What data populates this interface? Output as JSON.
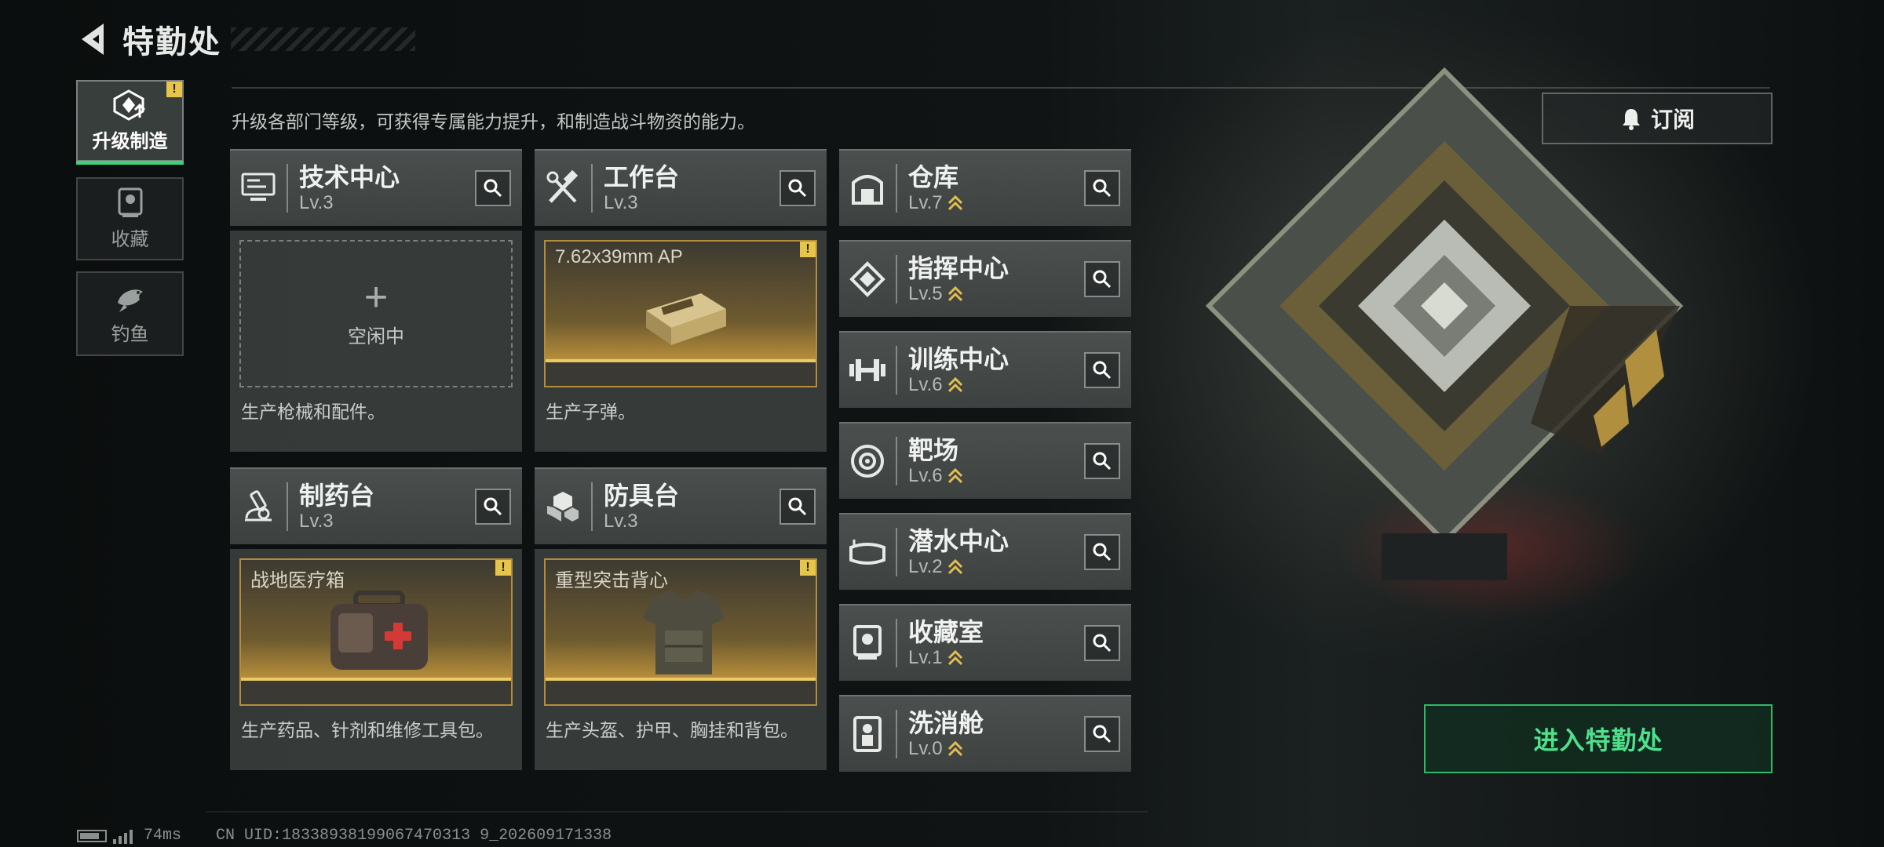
{
  "header": {
    "title": "特勤处",
    "back_icon": "back-arrow-icon"
  },
  "sidebar": {
    "items": [
      {
        "label": "升级制造",
        "icon": "upgrade-crafting-icon",
        "active": true,
        "alert": "!"
      },
      {
        "label": "收藏",
        "icon": "collection-icon",
        "active": false
      },
      {
        "label": "钓鱼",
        "icon": "fish-icon",
        "active": false
      }
    ]
  },
  "description": "升级各部门等级，可获得专属能力提升，和制造战斗物资的能力。",
  "production": [
    {
      "name": "技术中心",
      "level": "Lv.3",
      "icon": "tech-center-icon",
      "slot_state": "idle",
      "slot_text": "空闲中",
      "slot_plus": "+",
      "desc": "生产枪械和配件。"
    },
    {
      "name": "工作台",
      "level": "Lv.3",
      "icon": "workbench-icon",
      "slot_state": "item",
      "item_name": "7.62x39mm AP",
      "alert": "!",
      "desc": "生产子弹。"
    },
    {
      "name": "制药台",
      "level": "Lv.3",
      "icon": "pharmacy-icon",
      "slot_state": "item",
      "item_name": "战地医疗箱",
      "alert": "!",
      "desc": "生产药品、针剂和维修工具包。"
    },
    {
      "name": "防具台",
      "level": "Lv.3",
      "icon": "armor-bench-icon",
      "slot_state": "item",
      "item_name": "重型突击背心",
      "alert": "!",
      "desc": "生产头盔、护甲、胸挂和背包。"
    }
  ],
  "facilities": [
    {
      "name": "仓库",
      "level": "Lv.7",
      "icon": "warehouse-icon"
    },
    {
      "name": "指挥中心",
      "level": "Lv.5",
      "icon": "command-center-icon"
    },
    {
      "name": "训练中心",
      "level": "Lv.6",
      "icon": "dumbbell-icon"
    },
    {
      "name": "靶场",
      "level": "Lv.6",
      "icon": "target-icon"
    },
    {
      "name": "潜水中心",
      "level": "Lv.2",
      "icon": "diving-mask-icon"
    },
    {
      "name": "收藏室",
      "level": "Lv.1",
      "icon": "collection-room-icon"
    },
    {
      "name": "洗消舱",
      "level": "Lv.0",
      "icon": "decontamination-icon"
    }
  ],
  "subscribe": {
    "label": "订阅",
    "icon": "bell-icon"
  },
  "enter_button": {
    "label": "进入特勤处"
  },
  "footer": {
    "ping": "74ms",
    "uid": "CN UID:18338938199067470313 9_202609171338"
  },
  "colors": {
    "accent_green": "#3fd07a",
    "alert_yellow": "#e6c54a",
    "upgrade_chevron": "#e3bd4f",
    "slot_gold": "#c79a3d"
  }
}
